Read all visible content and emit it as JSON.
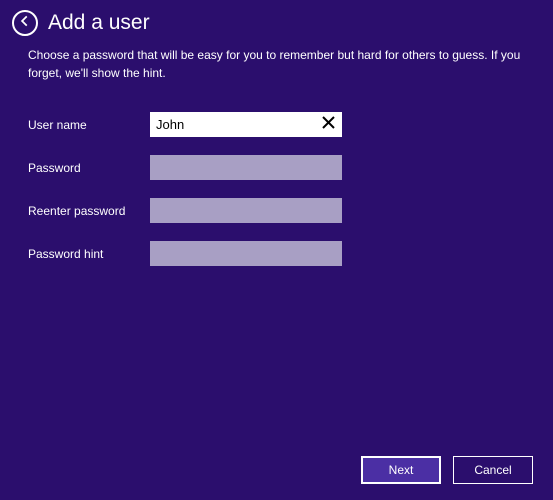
{
  "header": {
    "title": "Add a user"
  },
  "description": "Choose a password that will be easy for you to remember but hard for others to guess. If you forget, we'll show the hint.",
  "form": {
    "username": {
      "label": "User name",
      "value": "John"
    },
    "password": {
      "label": "Password",
      "value": ""
    },
    "reenter": {
      "label": "Reenter password",
      "value": ""
    },
    "hint": {
      "label": "Password hint",
      "value": ""
    }
  },
  "footer": {
    "next": "Next",
    "cancel": "Cancel"
  }
}
